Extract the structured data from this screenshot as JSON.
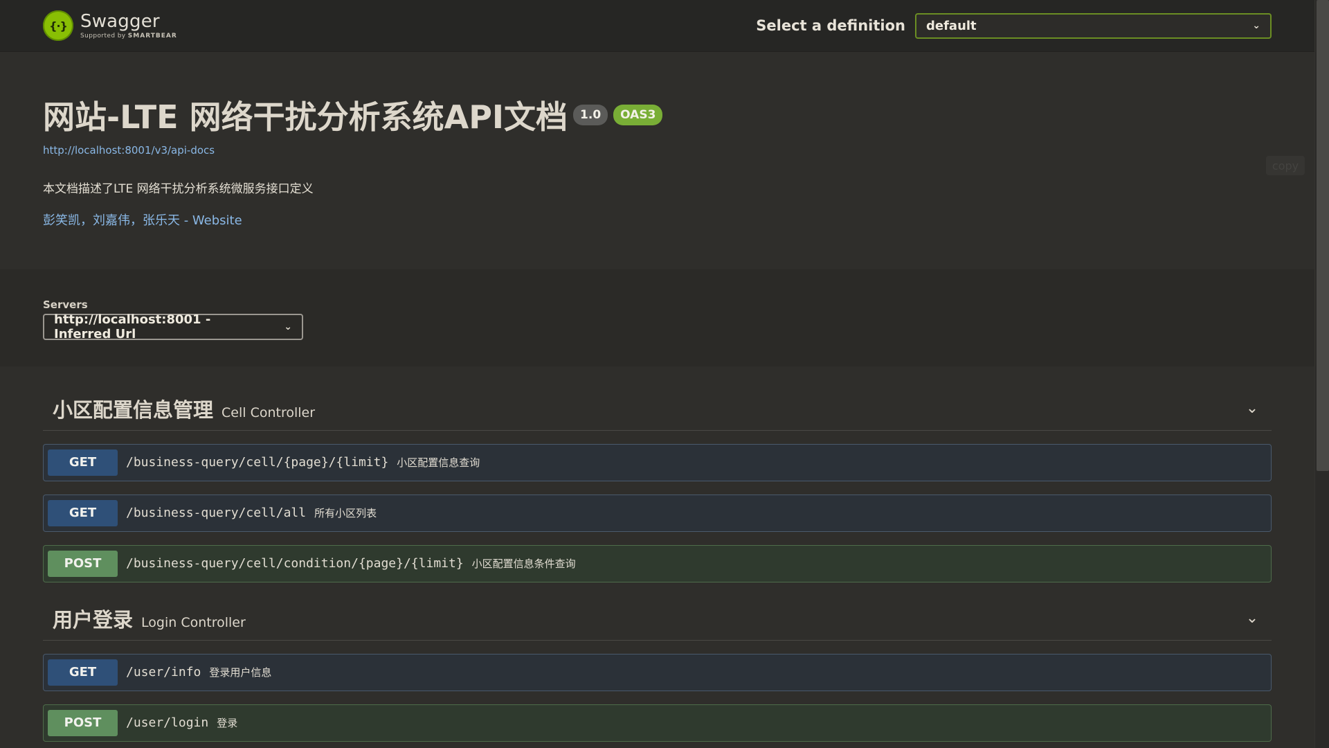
{
  "topbar": {
    "brand_title": "Swagger",
    "brand_supported": "Supported by",
    "brand_sponsor": "SMARTBEAR",
    "definition_label": "Select a definition",
    "definition_value": "default"
  },
  "info": {
    "title": "网站-LTE 网络干扰分析系统API文档",
    "version": "1.0",
    "oas": "OAS3",
    "api_docs_url": "http://localhost:8001/v3/api-docs",
    "description": "本文档描述了LTE 网络干扰分析系统微服务接口定义",
    "contact": "彭笑凯，刘嘉伟，张乐天 - Website",
    "copy_label": "copy"
  },
  "servers": {
    "label": "Servers",
    "selected": "http://localhost:8001 - Inferred Url"
  },
  "tags": [
    {
      "name": "小区配置信息管理",
      "description": "Cell Controller",
      "operations": [
        {
          "method": "GET",
          "path": "/business-query/cell/{page}/{limit}",
          "summary": "小区配置信息查询"
        },
        {
          "method": "GET",
          "path": "/business-query/cell/all",
          "summary": "所有小区列表"
        },
        {
          "method": "POST",
          "path": "/business-query/cell/condition/{page}/{limit}",
          "summary": "小区配置信息条件查询"
        }
      ]
    },
    {
      "name": "用户登录",
      "description": "Login Controller",
      "operations": [
        {
          "method": "GET",
          "path": "/user/info",
          "summary": "登录用户信息"
        },
        {
          "method": "POST",
          "path": "/user/login",
          "summary": "登录"
        }
      ]
    }
  ],
  "icons": {
    "brand": "swagger-logo-icon",
    "dropdown": "chevron-down-icon",
    "collapse": "chevron-down-icon"
  },
  "colors": {
    "background": "#2f2e2b",
    "topbar": "#262624",
    "swagger_green": "#89bf04",
    "get_badge": "#2f5078",
    "post_badge": "#5f8f5e",
    "link": "#8ab8e6"
  }
}
